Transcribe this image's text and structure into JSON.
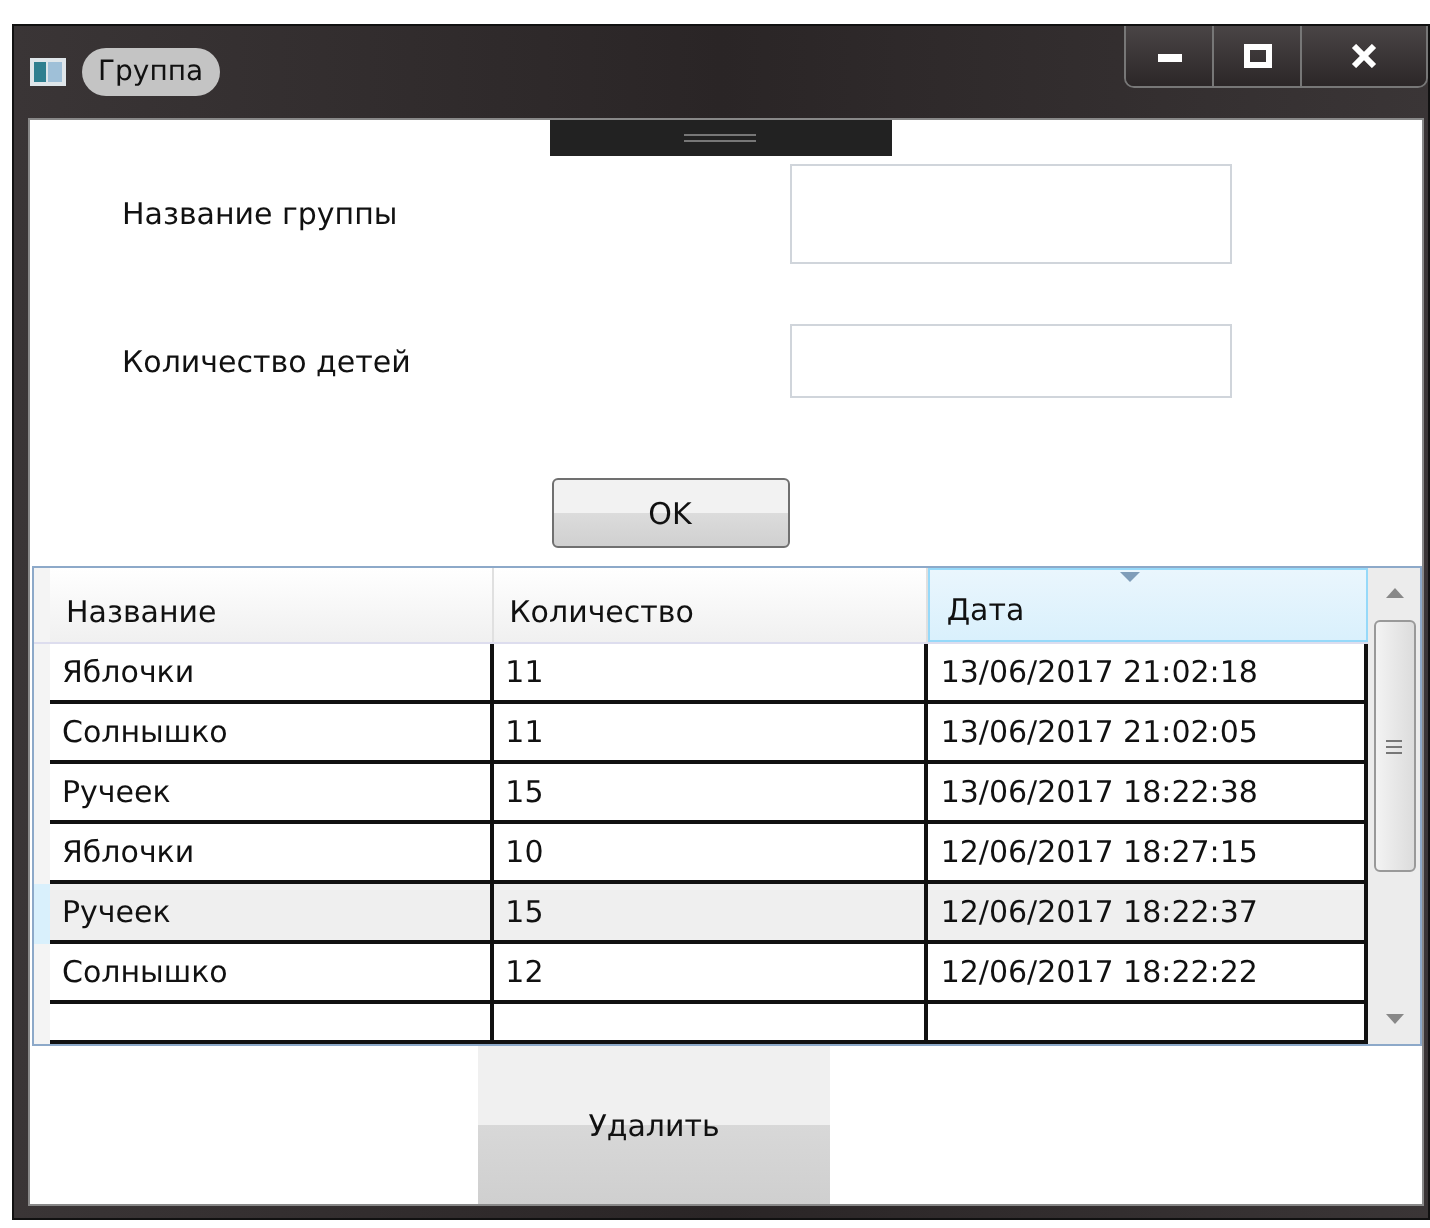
{
  "window": {
    "title": "Группа"
  },
  "form": {
    "fields": [
      {
        "label": "Название группы"
      },
      {
        "label": "Количество детей"
      }
    ],
    "ok_button": "OK"
  },
  "table": {
    "columns": [
      {
        "label": "Название",
        "sorted": false
      },
      {
        "label": "Количество",
        "sorted": false
      },
      {
        "label": "Дата",
        "sorted": true
      }
    ],
    "rows": [
      {
        "cells": [
          "Яблочки",
          "11",
          "13/06/2017 21:02:18"
        ],
        "selected": false
      },
      {
        "cells": [
          "Солнышко",
          "11",
          "13/06/2017 21:02:05"
        ],
        "selected": false
      },
      {
        "cells": [
          "Ручеек",
          "15",
          "13/06/2017 18:22:38"
        ],
        "selected": false
      },
      {
        "cells": [
          "Яблочки",
          "10",
          "12/06/2017 18:27:15"
        ],
        "selected": false
      },
      {
        "cells": [
          "Ручеек",
          "15",
          "12/06/2017 18:22:37"
        ],
        "selected": true
      },
      {
        "cells": [
          "Солнышко",
          "12",
          "12/06/2017 18:22:22"
        ],
        "selected": false
      }
    ]
  },
  "delete_button": "Удалить"
}
